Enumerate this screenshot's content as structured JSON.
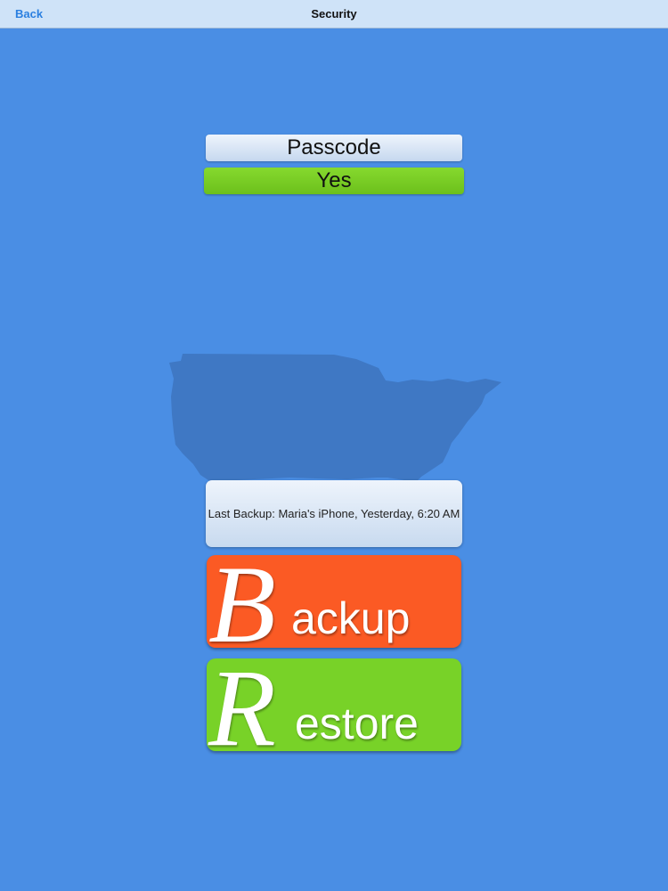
{
  "nav": {
    "back_label": "Back",
    "title": "Security"
  },
  "passcode": {
    "label": "Passcode",
    "value": "Yes"
  },
  "last_backup": {
    "text": "Last Backup: Maria's iPhone, Yesterday, 6:20 AM"
  },
  "backup_button": {
    "initial": "B",
    "rest": "ackup"
  },
  "restore_button": {
    "initial": "R",
    "rest": "estore"
  },
  "colors": {
    "background": "#4a8ee4",
    "navbar": "#cfe3f8",
    "accent_blue": "#2a7fe0",
    "green": "#78d228",
    "orange": "#fb5a24",
    "map": "#3f78c4"
  },
  "icons": {
    "map": "usa-map-icon"
  }
}
